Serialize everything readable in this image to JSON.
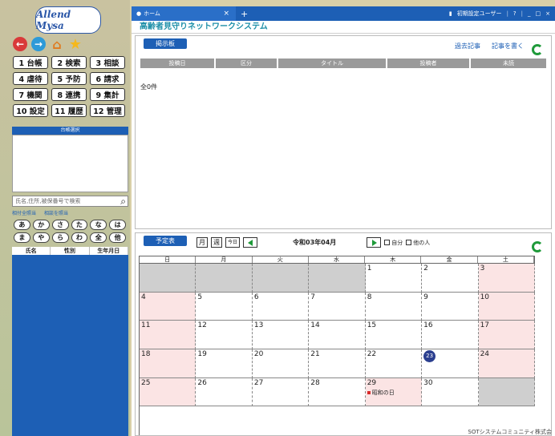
{
  "logo": {
    "text": "Allend Mysa"
  },
  "menu": [
    {
      "label": "1 台帳"
    },
    {
      "label": "2 検索"
    },
    {
      "label": "3 相談"
    },
    {
      "label": "4 虐待"
    },
    {
      "label": "5 予防"
    },
    {
      "label": "6 請求"
    },
    {
      "label": "7 機関"
    },
    {
      "label": "8 連携"
    },
    {
      "label": "9 集計"
    },
    {
      "label": "10 設定"
    },
    {
      "label": "11 履歴"
    },
    {
      "label": "12 管理"
    }
  ],
  "ledger": {
    "header": "台帳選択"
  },
  "search": {
    "placeholder": "氏名,住所,被保番号で検索",
    "opt1": "相付全照当",
    "opt2": "相談を照当"
  },
  "kana": [
    "あ",
    "か",
    "さ",
    "た",
    "な",
    "は",
    "ま",
    "や",
    "ら",
    "わ",
    "全",
    "他"
  ],
  "name_table": {
    "headers": [
      "氏名",
      "性別",
      "生年月日"
    ]
  },
  "topbar": {
    "tab": "ホーム",
    "user": "初期設定ユーザー"
  },
  "system_title": "高齢者見守りネットワークシステム",
  "bulletin": {
    "title": "掲示板",
    "link_past": "過去記事",
    "link_write": "記事を書く",
    "columns": [
      "投稿日",
      "区分",
      "タイトル",
      "投稿者",
      "未読"
    ],
    "count": "全0件"
  },
  "schedule": {
    "title": "予定表",
    "btn_month": "月",
    "btn_week": "週",
    "btn_today": "今日",
    "month_label": "令和03年04月",
    "chk_self": "自分",
    "chk_others": "他の人",
    "weekdays": [
      "日",
      "月",
      "火",
      "水",
      "木",
      "金",
      "土"
    ],
    "cells": [
      {
        "d": "",
        "t": "blank"
      },
      {
        "d": "",
        "t": "blank"
      },
      {
        "d": "",
        "t": "blank"
      },
      {
        "d": "",
        "t": "blank"
      },
      {
        "d": "1",
        "t": ""
      },
      {
        "d": "2",
        "t": ""
      },
      {
        "d": "3",
        "t": "weekend"
      },
      {
        "d": "4",
        "t": "weekend"
      },
      {
        "d": "5",
        "t": ""
      },
      {
        "d": "6",
        "t": ""
      },
      {
        "d": "7",
        "t": ""
      },
      {
        "d": "8",
        "t": ""
      },
      {
        "d": "9",
        "t": ""
      },
      {
        "d": "10",
        "t": "weekend"
      },
      {
        "d": "11",
        "t": "weekend"
      },
      {
        "d": "12",
        "t": ""
      },
      {
        "d": "13",
        "t": ""
      },
      {
        "d": "14",
        "t": ""
      },
      {
        "d": "15",
        "t": ""
      },
      {
        "d": "16",
        "t": ""
      },
      {
        "d": "17",
        "t": "weekend"
      },
      {
        "d": "18",
        "t": "weekend"
      },
      {
        "d": "19",
        "t": ""
      },
      {
        "d": "20",
        "t": ""
      },
      {
        "d": "21",
        "t": ""
      },
      {
        "d": "22",
        "t": ""
      },
      {
        "d": "23",
        "t": "today"
      },
      {
        "d": "24",
        "t": "weekend"
      },
      {
        "d": "25",
        "t": "weekend"
      },
      {
        "d": "26",
        "t": ""
      },
      {
        "d": "27",
        "t": ""
      },
      {
        "d": "28",
        "t": ""
      },
      {
        "d": "29",
        "t": "weekend",
        "event": "昭和の日"
      },
      {
        "d": "30",
        "t": ""
      },
      {
        "d": "",
        "t": "blank"
      }
    ]
  },
  "footer": "SOTシステムコミュニティ株式会"
}
